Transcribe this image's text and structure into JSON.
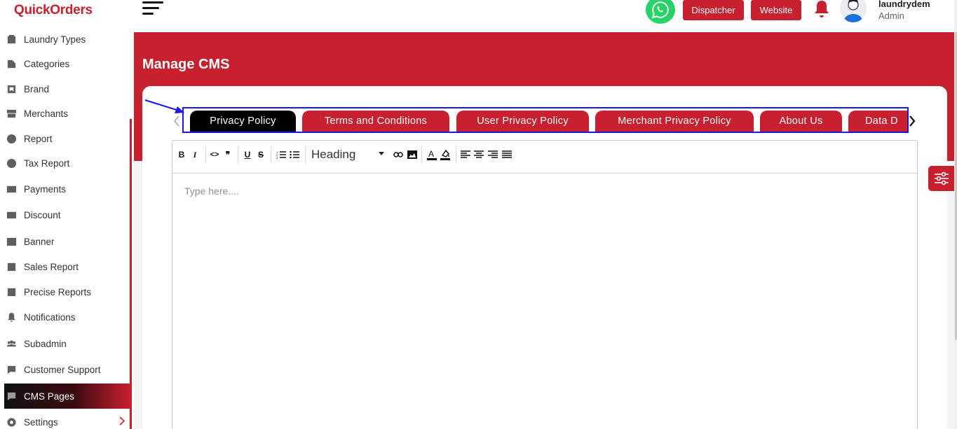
{
  "brand": {
    "name": "QuickOrders",
    "accent": "#c8202f"
  },
  "sidebar": {
    "items": [
      {
        "label": "Laundry Types",
        "icon": "washing-machine-icon"
      },
      {
        "label": "Categories",
        "icon": "folder-icon"
      },
      {
        "label": "Brand",
        "icon": "tag-icon"
      },
      {
        "label": "Merchants",
        "icon": "store-icon"
      },
      {
        "label": "Report",
        "icon": "report-icon"
      },
      {
        "label": "Tax Report",
        "icon": "tax-report-icon"
      },
      {
        "label": "Payments",
        "icon": "payment-card-icon"
      },
      {
        "label": "Discount",
        "icon": "discount-icon"
      },
      {
        "label": "Banner",
        "icon": "image-icon"
      },
      {
        "label": "Sales Report",
        "icon": "chart-icon"
      },
      {
        "label": "Precise Reports",
        "icon": "chart-icon"
      },
      {
        "label": "Notifications",
        "icon": "bell-icon"
      },
      {
        "label": "Subadmin",
        "icon": "users-icon"
      },
      {
        "label": "Customer Support",
        "icon": "chat-icon"
      },
      {
        "label": "CMS Pages",
        "icon": "chat-bubble-icon",
        "active": true
      },
      {
        "label": "Settings",
        "icon": "gear-icon"
      }
    ]
  },
  "header": {
    "dispatcher_label": "Dispatcher",
    "website_label": "Website",
    "user_name": "laundrydem",
    "user_role": "Admin"
  },
  "page": {
    "title": "Manage CMS"
  },
  "tabs": [
    {
      "label": "Privacy Policy",
      "active": true
    },
    {
      "label": "Terms and Conditions"
    },
    {
      "label": "User Privacy Policy"
    },
    {
      "label": "Merchant Privacy Policy"
    },
    {
      "label": "About Us"
    },
    {
      "label": "Data D"
    }
  ],
  "editor": {
    "heading_select": "Heading",
    "placeholder": "Type here....",
    "toolbar": {
      "bold": "B",
      "italic": "I",
      "code": "<>",
      "quote": "❞",
      "underline": "U",
      "strike": "S"
    }
  }
}
